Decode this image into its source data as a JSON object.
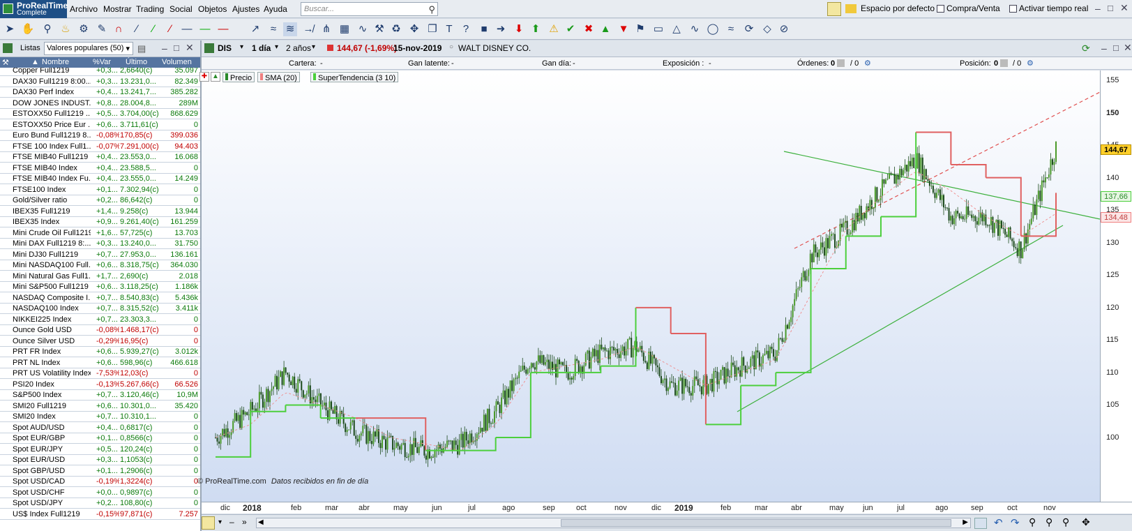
{
  "app": {
    "title_line1": "ProRealTime",
    "title_line2": "Complete"
  },
  "menu": [
    "Archivo",
    "Mostrar",
    "Trading",
    "Social",
    "Objetos",
    "Ajustes",
    "Ayuda"
  ],
  "search": {
    "placeholder": "Buscar..."
  },
  "topright": {
    "workspace": "Espacio por defecto",
    "buy_sell": "Compra/Venta",
    "realtime": "Activar tiempo real"
  },
  "lists_panel": {
    "lists_label": "Listas",
    "list_select": "Valores populares (50)",
    "columns": [
      "Nombre",
      "%Var",
      "Último",
      "Volumen"
    ],
    "rows": [
      {
        "name": "Copper Full1219",
        "var": "+0,3...",
        "last": "2,6640(c)",
        "vol": "35.097",
        "dir": "pos"
      },
      {
        "name": "DAX30 Full1219 8:00...",
        "var": "+0,3...",
        "last": "13.231,0...",
        "vol": "82.349",
        "dir": "pos"
      },
      {
        "name": "DAX30 Perf Index",
        "var": "+0,4...",
        "last": "13.241,7...",
        "vol": "385.282",
        "dir": "pos"
      },
      {
        "name": "DOW JONES INDUST...",
        "var": "+0,8...",
        "last": "28.004,8...",
        "vol": "289M",
        "dir": "pos"
      },
      {
        "name": "ESTOXX50 Full1219 ...",
        "var": "+0,5...",
        "last": "3.704,00(c)",
        "vol": "868.629",
        "dir": "pos"
      },
      {
        "name": "ESTOXX50 Price Eur ...",
        "var": "+0,6...",
        "last": "3.711,61(c)",
        "vol": "0",
        "dir": "pos"
      },
      {
        "name": "Euro Bund Full1219 8...",
        "var": "-0,08%",
        "last": "170,85(c)",
        "vol": "399.036",
        "dir": "neg"
      },
      {
        "name": "FTSE 100 Index Full1...",
        "var": "-0,07%",
        "last": "7.291,00(c)",
        "vol": "94.403",
        "dir": "neg"
      },
      {
        "name": "FTSE MIB40 Full1219",
        "var": "+0,4...",
        "last": "23.553,0...",
        "vol": "16.068",
        "dir": "pos"
      },
      {
        "name": "FTSE MIB40 Index",
        "var": "+0,4...",
        "last": "23.588,5...",
        "vol": "0",
        "dir": "pos"
      },
      {
        "name": "FTSE MIB40 Index Fu...",
        "var": "+0,4...",
        "last": "23.555,0...",
        "vol": "14.249",
        "dir": "pos"
      },
      {
        "name": "FTSE100 Index",
        "var": "+0,1...",
        "last": "7.302,94(c)",
        "vol": "0",
        "dir": "pos"
      },
      {
        "name": "Gold/Silver ratio",
        "var": "+0,2...",
        "last": "86,642(c)",
        "vol": "0",
        "dir": "pos"
      },
      {
        "name": "IBEX35 Full1219",
        "var": "+1,4...",
        "last": "9.258(c)",
        "vol": "13.944",
        "dir": "pos"
      },
      {
        "name": "IBEX35 Index",
        "var": "+0,9...",
        "last": "9.261,40(c)",
        "vol": "161.259",
        "dir": "pos"
      },
      {
        "name": "Mini Crude Oil Full1219",
        "var": "+1,6...",
        "last": "57,725(c)",
        "vol": "13.703",
        "dir": "pos"
      },
      {
        "name": "Mini DAX Full1219 8:...",
        "var": "+0,3...",
        "last": "13.240,0...",
        "vol": "31.750",
        "dir": "pos"
      },
      {
        "name": "Mini DJ30 Full1219",
        "var": "+0,7...",
        "last": "27.953,0...",
        "vol": "136.161",
        "dir": "pos"
      },
      {
        "name": "Mini NASDAQ100 Full...",
        "var": "+0,6...",
        "last": "8.318,75(c)",
        "vol": "364.030",
        "dir": "pos"
      },
      {
        "name": "Mini Natural Gas Full1...",
        "var": "+1,7...",
        "last": "2,690(c)",
        "vol": "2.018",
        "dir": "pos"
      },
      {
        "name": "Mini S&P500 Full1219",
        "var": "+0,6...",
        "last": "3.118,25(c)",
        "vol": "1.186k",
        "dir": "pos"
      },
      {
        "name": "NASDAQ Composite I...",
        "var": "+0,7...",
        "last": "8.540,83(c)",
        "vol": "5.436k",
        "dir": "pos"
      },
      {
        "name": "NASDAQ100 Index",
        "var": "+0,7...",
        "last": "8.315,52(c)",
        "vol": "3.411k",
        "dir": "pos"
      },
      {
        "name": "NIKKEI225 Index",
        "var": "+0,7...",
        "last": "23.303,3...",
        "vol": "0",
        "dir": "pos"
      },
      {
        "name": "Ounce Gold USD",
        "var": "-0,08%",
        "last": "1.468,17(c)",
        "vol": "0",
        "dir": "neg"
      },
      {
        "name": "Ounce Silver USD",
        "var": "-0,29%",
        "last": "16,95(c)",
        "vol": "0",
        "dir": "neg"
      },
      {
        "name": "PRT FR Index",
        "var": "+0,6...",
        "last": "5.939,27(c)",
        "vol": "3.012k",
        "dir": "pos"
      },
      {
        "name": "PRT NL Index",
        "var": "+0,6...",
        "last": "598,96(c)",
        "vol": "466.618",
        "dir": "pos"
      },
      {
        "name": "PRT US Volatility Index",
        "var": "-7,53%",
        "last": "12,03(c)",
        "vol": "0",
        "dir": "neg"
      },
      {
        "name": "PSI20 Index",
        "var": "-0,13%",
        "last": "5.267,66(c)",
        "vol": "66.526",
        "dir": "neg"
      },
      {
        "name": "S&P500 Index",
        "var": "+0,7...",
        "last": "3.120,46(c)",
        "vol": "10,9M",
        "dir": "pos"
      },
      {
        "name": "SMI20 Full1219",
        "var": "+0,6...",
        "last": "10.301,0...",
        "vol": "35.420",
        "dir": "pos"
      },
      {
        "name": "SMI20 Index",
        "var": "+0,7...",
        "last": "10.310,1...",
        "vol": "0",
        "dir": "pos"
      },
      {
        "name": "Spot AUD/USD",
        "var": "+0,4...",
        "last": "0,6817(c)",
        "vol": "0",
        "dir": "pos"
      },
      {
        "name": "Spot EUR/GBP",
        "var": "+0,1...",
        "last": "0,8566(c)",
        "vol": "0",
        "dir": "pos"
      },
      {
        "name": "Spot EUR/JPY",
        "var": "+0,5...",
        "last": "120,24(c)",
        "vol": "0",
        "dir": "pos"
      },
      {
        "name": "Spot EUR/USD",
        "var": "+0,3...",
        "last": "1,1053(c)",
        "vol": "0",
        "dir": "pos"
      },
      {
        "name": "Spot GBP/USD",
        "var": "+0,1...",
        "last": "1,2906(c)",
        "vol": "0",
        "dir": "pos"
      },
      {
        "name": "Spot USD/CAD",
        "var": "-0,19%",
        "last": "1,3224(c)",
        "vol": "0",
        "dir": "neg"
      },
      {
        "name": "Spot USD/CHF",
        "var": "+0,0...",
        "last": "0,9897(c)",
        "vol": "0",
        "dir": "pos"
      },
      {
        "name": "Spot USD/JPY",
        "var": "+0,2...",
        "last": "108,80(c)",
        "vol": "0",
        "dir": "pos"
      },
      {
        "name": "US$ Index Full1219",
        "var": "-0,15%",
        "last": "97,871(c)",
        "vol": "7.257",
        "dir": "neg"
      }
    ]
  },
  "chart_panel": {
    "symbol": "DIS",
    "period": "1 día",
    "range": "2 años",
    "price_change": "144,67 (-1,69%)",
    "date": "15-nov-2019",
    "company": "WALT DISNEY CO.",
    "info": {
      "cartera": "Cartera:",
      "cartera_val": "-",
      "gan_latente": "Gan latente:",
      "gan_latente_val": "-",
      "gan_dia": "Gan día:",
      "gan_dia_val": "-",
      "exposicion": "Exposición :",
      "exposicion_val": "-",
      "ordenes": "Órdenes:",
      "ordenes_val": "0",
      "ordenes_val2": "/ 0",
      "posicion": "Posición:",
      "posicion_val": "0",
      "posicion_val2": "/ 0"
    },
    "legend": [
      "Precio",
      "SMA (20)",
      "SuperTendencia (3 10)"
    ],
    "watermark": "© ProRealTime.com",
    "data_note": "Datos recibidos en fin de día",
    "y_ticks": [
      "155",
      "150",
      "145",
      "140",
      "135",
      "130",
      "125",
      "120",
      "115",
      "110",
      "105",
      "100"
    ],
    "x_ticks": [
      "dic",
      "2018",
      "feb",
      "mar",
      "abr",
      "may",
      "jun",
      "jul",
      "ago",
      "sep",
      "oct",
      "nov",
      "dic",
      "2019",
      "feb",
      "mar",
      "abr",
      "may",
      "jun",
      "jul",
      "ago",
      "sep",
      "oct",
      "nov"
    ],
    "price_badges": {
      "last": "144,67",
      "supertrend": "137,66",
      "sma": "134,48"
    },
    "colors": {
      "up": "#1c6e1c",
      "supertrend_up": "#4ccf3c",
      "supertrend_down": "#e06060",
      "sma": "#f08080"
    }
  },
  "chart_data": {
    "type": "line",
    "title": "WALT DISNEY CO.",
    "ylim": [
      95,
      157
    ],
    "x": [
      "2017-11",
      "2017-12",
      "2018-01",
      "2018-02",
      "2018-03",
      "2018-04",
      "2018-05",
      "2018-06",
      "2018-07",
      "2018-08",
      "2018-09",
      "2018-10",
      "2018-11",
      "2018-12",
      "2019-01",
      "2019-02",
      "2019-03",
      "2019-04",
      "2019-05",
      "2019-06",
      "2019-07",
      "2019-08",
      "2019-09",
      "2019-10",
      "2019-11"
    ],
    "series": [
      {
        "name": "Precio",
        "values": [
          100,
          104,
          110,
          105,
          101,
          99,
          98,
          99,
          104,
          112,
          110,
          113,
          114,
          108,
          108,
          111,
          113,
          128,
          132,
          138,
          143,
          134,
          134,
          129,
          144.67
        ]
      },
      {
        "name": "SMA (20)",
        "values": [
          100,
          102,
          107,
          105,
          103,
          100,
          99,
          98,
          102,
          110,
          111,
          112,
          114,
          111,
          108,
          110,
          112,
          122,
          132,
          137,
          141,
          138,
          134,
          131,
          134.48
        ]
      },
      {
        "name": "SuperTendencia (3 10)",
        "values": [
          97,
          104,
          105,
          103,
          103,
          103,
          98,
          98,
          100,
          110,
          110,
          111,
          120,
          116,
          102,
          108,
          110,
          126,
          131,
          134,
          147,
          142,
          140,
          131,
          137.66
        ]
      }
    ]
  }
}
